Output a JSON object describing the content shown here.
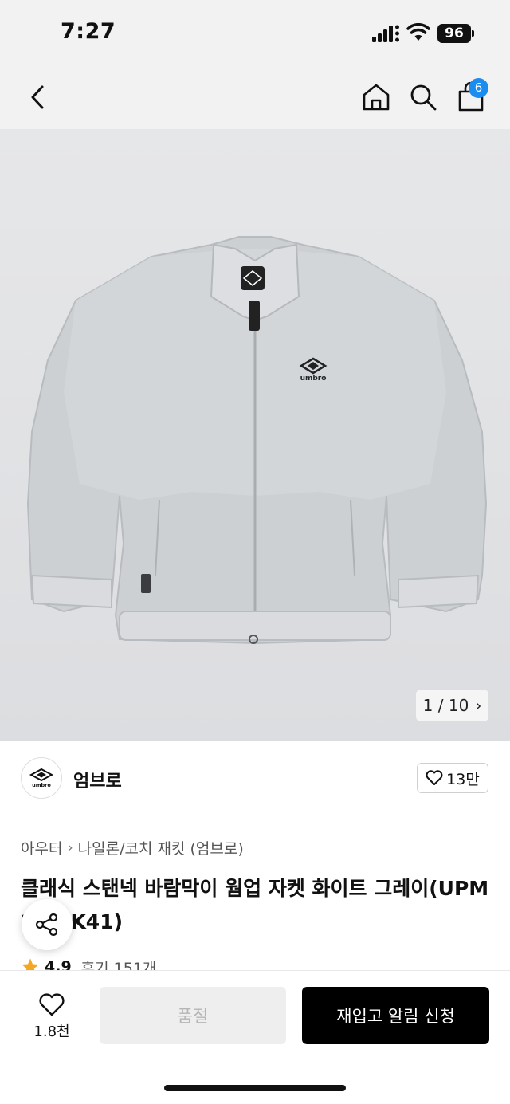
{
  "status_bar": {
    "time": "7:27",
    "battery": "96"
  },
  "header": {
    "cart_count": "6"
  },
  "gallery": {
    "indicator": "1 / 10",
    "chevron": "›",
    "logo_text": "umbro"
  },
  "brand": {
    "name": "엄브로",
    "logo_text": "umbro",
    "likes": "13만"
  },
  "breadcrumb": {
    "category": "아우터",
    "separator": "›",
    "subcategory": "나일론/코치 재킷 (엄브로)"
  },
  "product": {
    "title": "클래식 스탠넥 바람막이 웜업 자켓 화이트 그레이(UPM23CJK41)",
    "rating": "4.9",
    "review_label": "후기 151개"
  },
  "bottom_bar": {
    "wish_count": "1.8천",
    "soldout_label": "품절",
    "restock_label": "재입고 알림 신청"
  },
  "colors": {
    "accent_badge": "#1b8cf0",
    "star": "#f5a623",
    "primary_button": "#000000"
  },
  "icons": [
    "back-icon",
    "home-icon",
    "search-icon",
    "shopping-bag-icon",
    "heart-icon",
    "share-icon",
    "star-icon",
    "chevron-right-icon"
  ]
}
